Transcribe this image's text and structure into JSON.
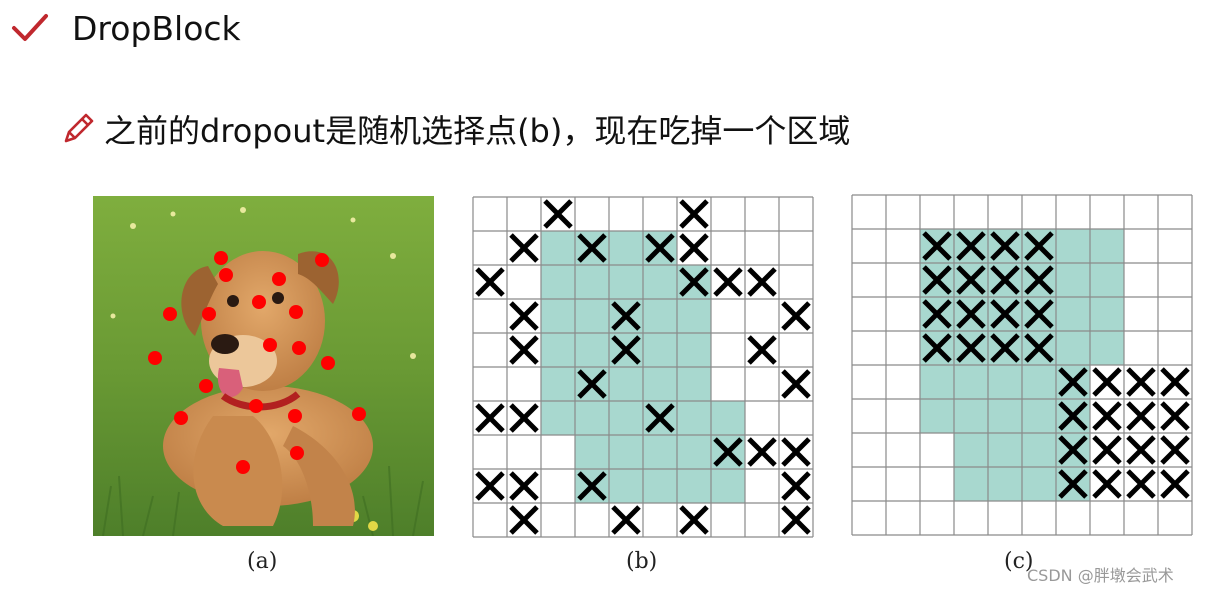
{
  "slide": {
    "title": "DropBlock",
    "bullet": "之前的dropout是随机选择点(b)，现在吃掉一个区域"
  },
  "figures": {
    "a": {
      "caption": "(a)"
    },
    "b": {
      "caption": "(b)",
      "rows": 10,
      "cols": 10,
      "teal_cells": [
        [
          1,
          2
        ],
        [
          1,
          3
        ],
        [
          1,
          4
        ],
        [
          1,
          5
        ],
        [
          2,
          2
        ],
        [
          2,
          3
        ],
        [
          2,
          4
        ],
        [
          2,
          5
        ],
        [
          2,
          6
        ],
        [
          3,
          2
        ],
        [
          3,
          3
        ],
        [
          3,
          4
        ],
        [
          3,
          5
        ],
        [
          3,
          6
        ],
        [
          4,
          2
        ],
        [
          4,
          3
        ],
        [
          4,
          4
        ],
        [
          4,
          5
        ],
        [
          4,
          6
        ],
        [
          5,
          2
        ],
        [
          5,
          3
        ],
        [
          5,
          4
        ],
        [
          5,
          5
        ],
        [
          5,
          6
        ],
        [
          6,
          2
        ],
        [
          6,
          3
        ],
        [
          6,
          4
        ],
        [
          6,
          5
        ],
        [
          6,
          6
        ],
        [
          6,
          7
        ],
        [
          7,
          3
        ],
        [
          7,
          4
        ],
        [
          7,
          5
        ],
        [
          7,
          6
        ],
        [
          7,
          7
        ],
        [
          8,
          3
        ],
        [
          8,
          4
        ],
        [
          8,
          5
        ],
        [
          8,
          6
        ],
        [
          8,
          7
        ]
      ],
      "x_cells": [
        [
          0,
          2
        ],
        [
          0,
          6
        ],
        [
          1,
          1
        ],
        [
          1,
          3
        ],
        [
          1,
          5
        ],
        [
          1,
          6
        ],
        [
          2,
          0
        ],
        [
          2,
          6
        ],
        [
          2,
          7
        ],
        [
          2,
          8
        ],
        [
          3,
          1
        ],
        [
          3,
          4
        ],
        [
          3,
          9
        ],
        [
          4,
          1
        ],
        [
          4,
          4
        ],
        [
          4,
          8
        ],
        [
          5,
          3
        ],
        [
          5,
          9
        ],
        [
          6,
          0
        ],
        [
          6,
          1
        ],
        [
          6,
          5
        ],
        [
          7,
          7
        ],
        [
          7,
          8
        ],
        [
          7,
          9
        ],
        [
          8,
          0
        ],
        [
          8,
          1
        ],
        [
          8,
          3
        ],
        [
          8,
          9
        ],
        [
          9,
          1
        ],
        [
          9,
          4
        ],
        [
          9,
          6
        ],
        [
          9,
          9
        ]
      ]
    },
    "c": {
      "caption": "(c)",
      "rows": 10,
      "cols": 10,
      "teal_cells": [
        [
          1,
          2
        ],
        [
          1,
          3
        ],
        [
          1,
          4
        ],
        [
          1,
          5
        ],
        [
          1,
          6
        ],
        [
          1,
          7
        ],
        [
          2,
          2
        ],
        [
          2,
          3
        ],
        [
          2,
          4
        ],
        [
          2,
          5
        ],
        [
          2,
          6
        ],
        [
          2,
          7
        ],
        [
          3,
          2
        ],
        [
          3,
          3
        ],
        [
          3,
          4
        ],
        [
          3,
          5
        ],
        [
          3,
          6
        ],
        [
          3,
          7
        ],
        [
          4,
          2
        ],
        [
          4,
          3
        ],
        [
          4,
          4
        ],
        [
          4,
          5
        ],
        [
          4,
          6
        ],
        [
          4,
          7
        ],
        [
          5,
          2
        ],
        [
          5,
          3
        ],
        [
          5,
          4
        ],
        [
          5,
          5
        ],
        [
          5,
          6
        ],
        [
          6,
          2
        ],
        [
          6,
          3
        ],
        [
          6,
          4
        ],
        [
          6,
          5
        ],
        [
          6,
          6
        ],
        [
          7,
          3
        ],
        [
          7,
          4
        ],
        [
          7,
          5
        ],
        [
          7,
          6
        ],
        [
          8,
          3
        ],
        [
          8,
          4
        ],
        [
          8,
          5
        ],
        [
          8,
          6
        ]
      ],
      "x_cells": [
        [
          1,
          2
        ],
        [
          1,
          3
        ],
        [
          1,
          4
        ],
        [
          1,
          5
        ],
        [
          2,
          2
        ],
        [
          2,
          3
        ],
        [
          2,
          4
        ],
        [
          2,
          5
        ],
        [
          3,
          2
        ],
        [
          3,
          3
        ],
        [
          3,
          4
        ],
        [
          3,
          5
        ],
        [
          4,
          2
        ],
        [
          4,
          3
        ],
        [
          4,
          4
        ],
        [
          4,
          5
        ],
        [
          5,
          6
        ],
        [
          5,
          7
        ],
        [
          5,
          8
        ],
        [
          5,
          9
        ],
        [
          6,
          6
        ],
        [
          6,
          7
        ],
        [
          6,
          8
        ],
        [
          6,
          9
        ],
        [
          7,
          6
        ],
        [
          7,
          7
        ],
        [
          7,
          8
        ],
        [
          7,
          9
        ],
        [
          8,
          6
        ],
        [
          8,
          7
        ],
        [
          8,
          8
        ],
        [
          8,
          9
        ]
      ]
    }
  },
  "colors": {
    "teal": "#a8d8cf",
    "grid_line": "#8a8a8a",
    "dot": "#ff0000",
    "accent_icon": "#c0282e"
  },
  "icons": [
    "check-icon",
    "pencil-icon"
  ],
  "watermark": "CSDN @胖墩会武术"
}
